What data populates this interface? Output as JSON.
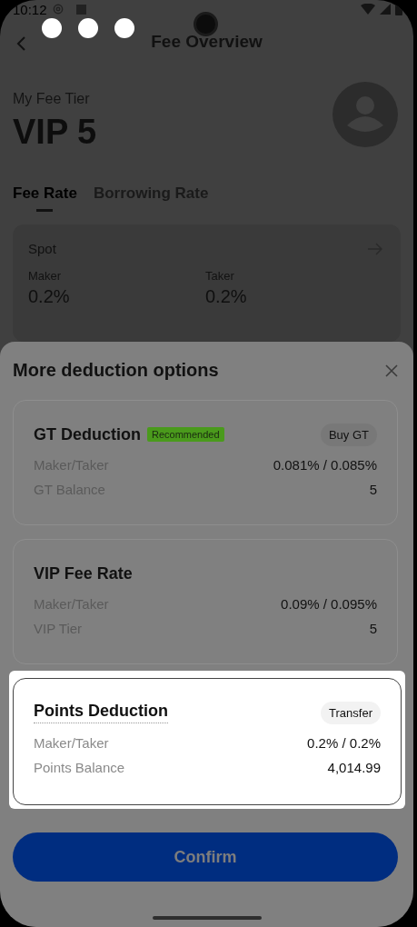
{
  "status_bar": {
    "time": "10:12"
  },
  "header": {
    "title": "Fee Overview"
  },
  "tier": {
    "label": "My Fee Tier",
    "value": "VIP 5"
  },
  "tabs": [
    {
      "label": "Fee Rate",
      "selected": true
    },
    {
      "label": "Borrowing Rate",
      "selected": false
    }
  ],
  "spot_card": {
    "title": "Spot",
    "columns": [
      {
        "label": "Maker",
        "value": "0.2%"
      },
      {
        "label": "Taker",
        "value": "0.2%"
      }
    ]
  },
  "sheet": {
    "title": "More deduction options",
    "options": [
      {
        "title": "GT Deduction",
        "badge": "Recommended",
        "action": "Buy GT",
        "highlighted": false,
        "dotted_underline": false,
        "rows": [
          {
            "label": "Maker/Taker",
            "value": "0.081% / 0.085%"
          },
          {
            "label": "GT Balance",
            "value": "5"
          }
        ]
      },
      {
        "title": "VIP Fee Rate",
        "highlighted": false,
        "dotted_underline": false,
        "rows": [
          {
            "label": "Maker/Taker",
            "value": "0.09% / 0.095%"
          },
          {
            "label": "VIP Tier",
            "value": "5"
          }
        ]
      },
      {
        "title": "Points Deduction",
        "action": "Transfer",
        "highlighted": true,
        "dotted_underline": true,
        "rows": [
          {
            "label": "Maker/Taker",
            "value": "0.2% / 0.2%"
          },
          {
            "label": "Points Balance",
            "value": "4,014.99"
          }
        ]
      }
    ],
    "confirm": "Confirm"
  }
}
